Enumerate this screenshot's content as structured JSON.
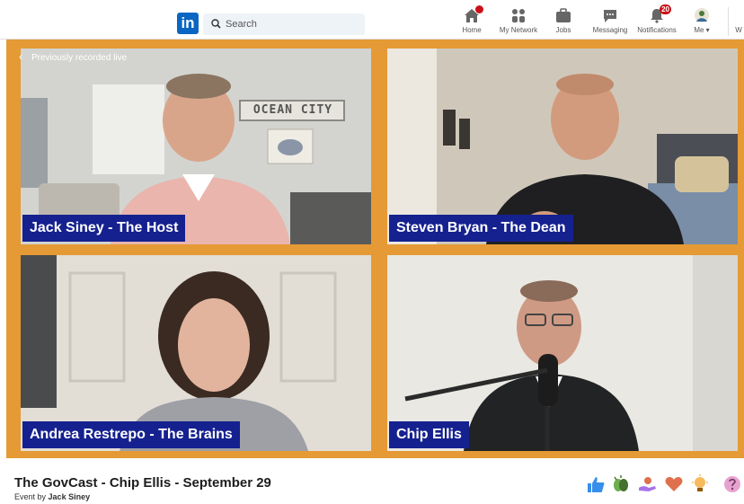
{
  "nav": {
    "search_placeholder": "Search",
    "items": [
      {
        "label": "Home",
        "icon": "home-icon",
        "badge": "dot"
      },
      {
        "label": "My Network",
        "icon": "network-icon"
      },
      {
        "label": "Jobs",
        "icon": "briefcase-icon"
      },
      {
        "label": "Messaging",
        "icon": "messaging-icon"
      },
      {
        "label": "Notifications",
        "icon": "bell-icon",
        "badge": "20"
      },
      {
        "label": "Me",
        "icon": "avatar"
      }
    ],
    "overflow_label": "W"
  },
  "video": {
    "back_label": "Previously recorded live",
    "participants": [
      {
        "name": "Jack Siney - The Host"
      },
      {
        "name": "Steven Bryan - The Dean"
      },
      {
        "name": "Andrea Restrepo - The Brains"
      },
      {
        "name": "Chip Ellis"
      }
    ],
    "sign_text": "OCEAN CITY",
    "frame_color": "#e59a35",
    "tag_color": "#15218f"
  },
  "event": {
    "title": "The GovCast - Chip Ellis - September 29",
    "by_prefix": "Event by",
    "organizer": "Jack Siney"
  },
  "reactions": [
    "like-icon",
    "celebrate-icon",
    "support-icon",
    "love-icon",
    "insightful-icon",
    "curious-icon"
  ],
  "colors": {
    "linkedin_blue": "#0a66c2",
    "badge_red": "#cc1016"
  }
}
